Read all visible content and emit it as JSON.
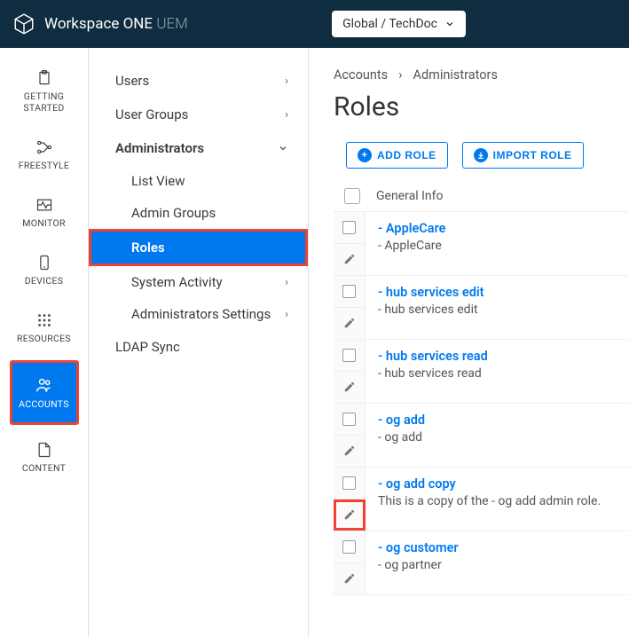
{
  "header": {
    "product": "Workspace ONE",
    "product_suffix": "UEM",
    "org_selector": "Global / TechDoc"
  },
  "rail": {
    "items": [
      {
        "key": "getting-started",
        "label": "GETTING STARTED",
        "icon": "clipboard"
      },
      {
        "key": "freestyle",
        "label": "FREESTYLE",
        "icon": "nodes"
      },
      {
        "key": "monitor",
        "label": "MONITOR",
        "icon": "pulse"
      },
      {
        "key": "devices",
        "label": "DEVICES",
        "icon": "phone"
      },
      {
        "key": "resources",
        "label": "RESOURCES",
        "icon": "grid"
      },
      {
        "key": "accounts",
        "label": "ACCOUNTS",
        "icon": "users"
      },
      {
        "key": "content",
        "label": "CONTENT",
        "icon": "file"
      }
    ]
  },
  "subnav": {
    "users": "Users",
    "user_groups": "User Groups",
    "administrators": "Administrators",
    "admin_children": {
      "list_view": "List View",
      "admin_groups": "Admin Groups",
      "roles": "Roles",
      "system_activity": "System Activity",
      "admin_settings": "Administrators Settings"
    },
    "ldap_sync": "LDAP Sync"
  },
  "breadcrumb": {
    "a": "Accounts",
    "b": "Administrators"
  },
  "page_title": "Roles",
  "actions": {
    "add": "ADD ROLE",
    "import": "IMPORT ROLE"
  },
  "col_header": "General Info",
  "roles": [
    {
      "name": "- AppleCare",
      "desc": "- AppleCare"
    },
    {
      "name": "- hub services edit",
      "desc": "- hub services edit"
    },
    {
      "name": "- hub services read",
      "desc": "- hub services read"
    },
    {
      "name": "- og add",
      "desc": "- og add"
    },
    {
      "name": "- og add copy",
      "desc": "This is a copy of the - og add admin role."
    },
    {
      "name": "- og customer",
      "desc": "- og partner"
    }
  ]
}
